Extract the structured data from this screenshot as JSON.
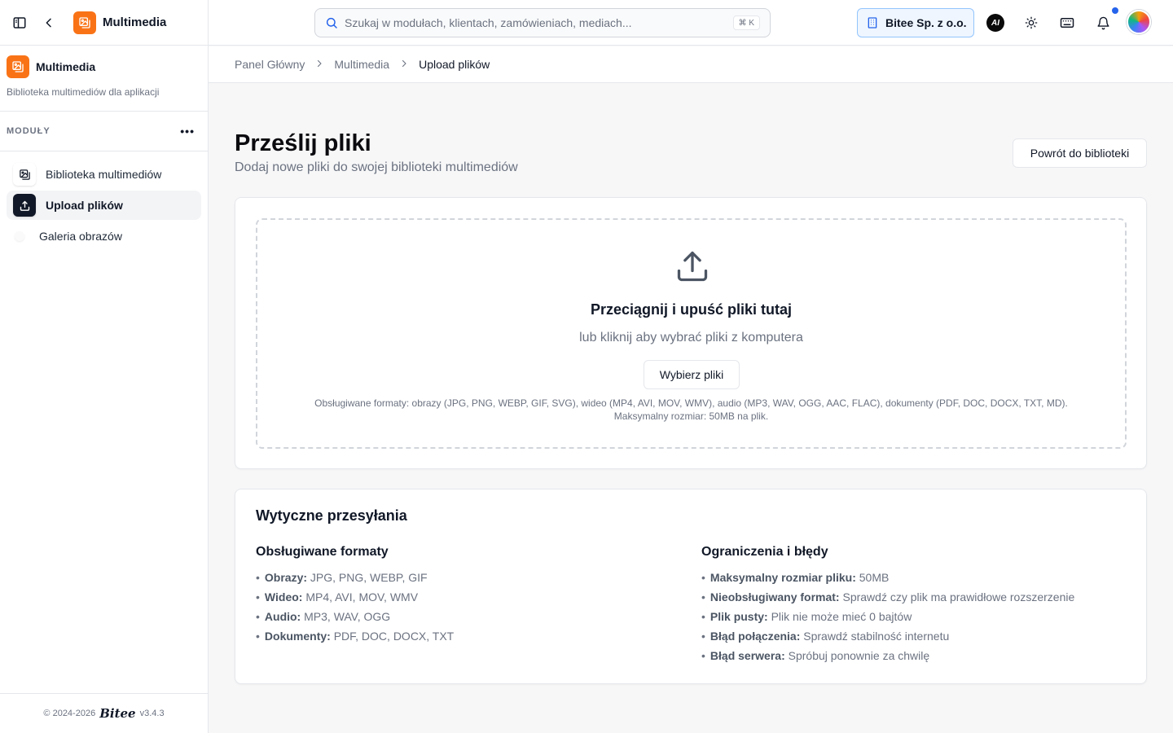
{
  "colors": {
    "accent": "#f97316",
    "active_nav": "#111827",
    "company_bg": "#eff6ff",
    "notification": "#2563eb"
  },
  "sidebar": {
    "app_name": "Multimedia",
    "module": {
      "name": "Multimedia",
      "description": "Biblioteka multimediów dla aplikacji"
    },
    "section_label": "MODUŁY",
    "items": [
      {
        "label": "Biblioteka multimediów",
        "icon": "image-gallery-icon"
      },
      {
        "label": "Upload plików",
        "icon": "upload-icon",
        "active": true
      },
      {
        "label": "Galeria obrazów",
        "icon": "dot-icon"
      }
    ],
    "footer": {
      "copyright": "© 2024-2026",
      "brand": "Bitee",
      "version": "v3.4.3"
    }
  },
  "header": {
    "search": {
      "placeholder": "Szukaj w modułach, klientach, zamówieniach, mediach...",
      "shortcut": "⌘ K"
    },
    "company": "Bitee Sp. z o.o.",
    "ai_label": "AI"
  },
  "breadcrumb": [
    "Panel Główny",
    "Multimedia",
    "Upload plików"
  ],
  "page": {
    "title": "Prześlij pliki",
    "subtitle": "Dodaj nowe pliki do swojej biblioteki multimediów",
    "back_button": "Powrót do biblioteki"
  },
  "dropzone": {
    "title": "Przeciągnij i upuść pliki tutaj",
    "subtitle": "lub kliknij aby wybrać pliki z komputera",
    "button": "Wybierz pliki",
    "info_line1": "Obsługiwane formaty: obrazy (JPG, PNG, WEBP, GIF, SVG), wideo (MP4, AVI, MOV, WMV), audio (MP3, WAV, OGG, AAC, FLAC), dokumenty (PDF, DOC, DOCX, TXT, MD).",
    "info_line2": "Maksymalny rozmiar: 50MB na plik."
  },
  "guidelines": {
    "title": "Wytyczne przesyłania",
    "formats": {
      "title": "Obsługiwane formaty",
      "items": [
        {
          "key": "Obrazy:",
          "value": "JPG, PNG, WEBP, GIF"
        },
        {
          "key": "Wideo:",
          "value": "MP4, AVI, MOV, WMV"
        },
        {
          "key": "Audio:",
          "value": "MP3, WAV, OGG"
        },
        {
          "key": "Dokumenty:",
          "value": "PDF, DOC, DOCX, TXT"
        }
      ]
    },
    "limits": {
      "title": "Ograniczenia i błędy",
      "items": [
        {
          "key": "Maksymalny rozmiar pliku:",
          "value": "50MB"
        },
        {
          "key": "Nieobsługiwany format:",
          "value": "Sprawdź czy plik ma prawidłowe rozszerzenie"
        },
        {
          "key": "Plik pusty:",
          "value": "Plik nie może mieć 0 bajtów"
        },
        {
          "key": "Błąd połączenia:",
          "value": "Sprawdź stabilność internetu"
        },
        {
          "key": "Błąd serwera:",
          "value": "Spróbuj ponownie za chwilę"
        }
      ]
    }
  }
}
